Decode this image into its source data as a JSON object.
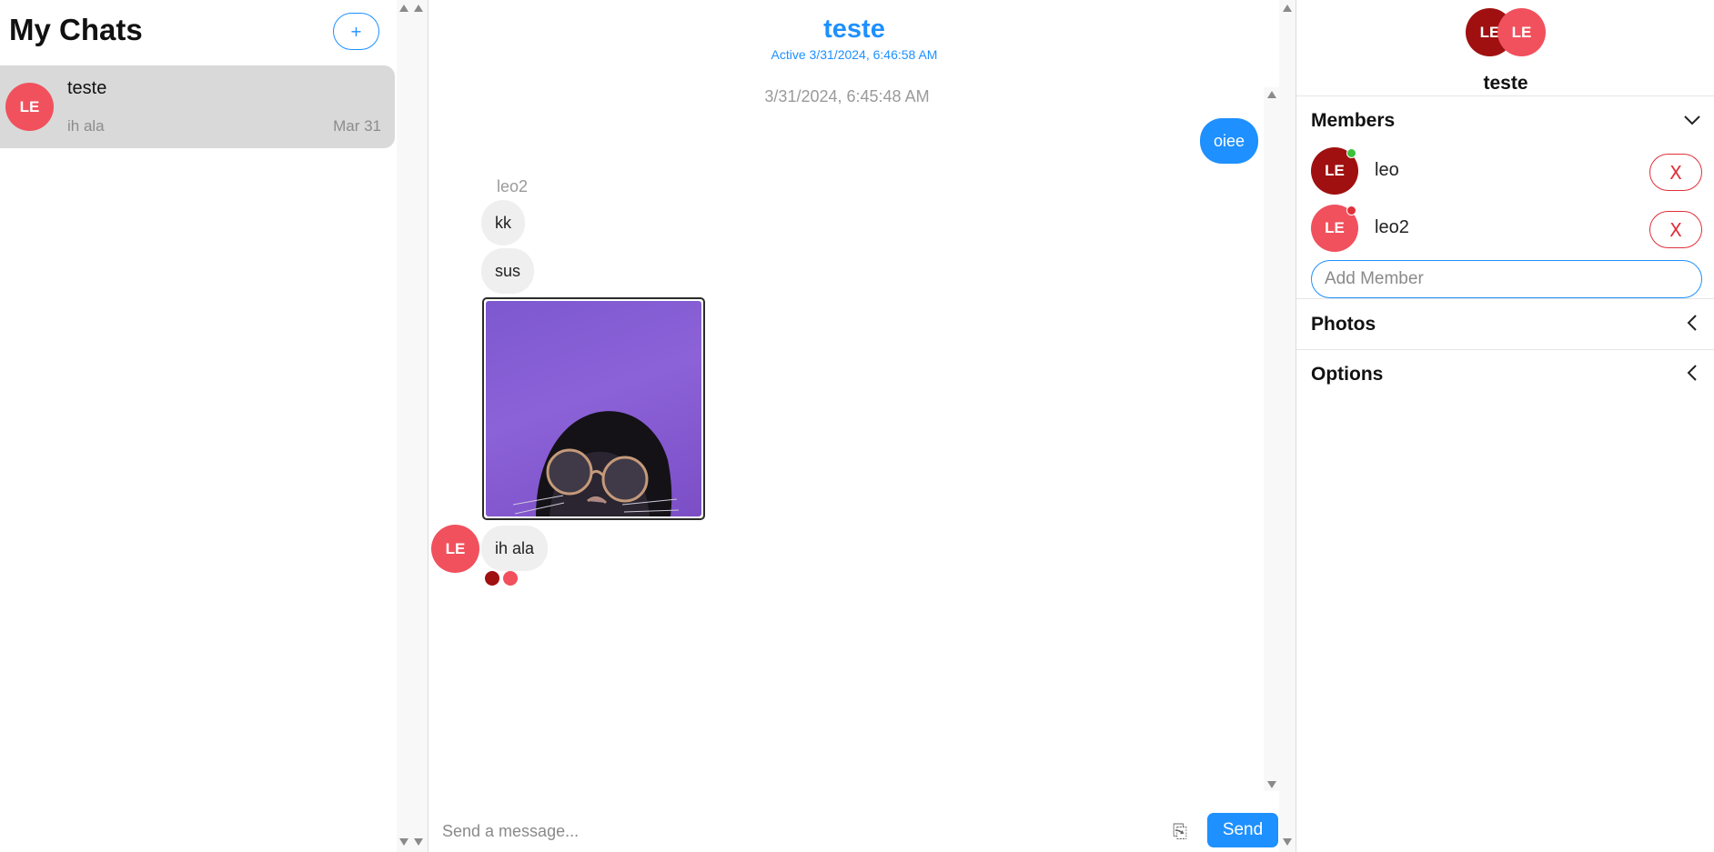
{
  "sidebar": {
    "title": "My Chats",
    "new_chat_label": "+",
    "chats": [
      {
        "initials": "LE",
        "name": "teste",
        "last_message": "ih ala",
        "date": "Mar 31",
        "avatar_color": "#f0515d",
        "selected": true
      }
    ]
  },
  "chat": {
    "title": "teste",
    "active_status": "Active 3/31/2024, 6:46:58 AM",
    "timestamp": "3/31/2024, 6:45:48 AM",
    "messages": [
      {
        "direction": "out",
        "text": "oiee"
      },
      {
        "direction": "in",
        "sender": "leo2",
        "text": "kk"
      },
      {
        "direction": "in",
        "text": "sus"
      },
      {
        "direction": "in",
        "type": "image"
      },
      {
        "direction": "in",
        "text": "ih ala",
        "avatar_initials": "LE"
      }
    ],
    "read_receipt_colors": [
      "#a01010",
      "#f0515d"
    ],
    "composer": {
      "placeholder": "Send a message...",
      "send_label": "Send",
      "attach_icon": "paperclip-icon"
    }
  },
  "details": {
    "group_avatars": [
      {
        "initials": "LE",
        "color": "#a01010"
      },
      {
        "initials": "LE",
        "color": "#f0515d"
      }
    ],
    "group_name": "teste",
    "members_title": "Members",
    "members": [
      {
        "initials": "LE",
        "name": "leo",
        "avatar_color": "#a01010",
        "status": "online",
        "status_color": "#3cc13b",
        "remove_label": "X"
      },
      {
        "initials": "LE",
        "name": "leo2",
        "avatar_color": "#f0515d",
        "status": "offline",
        "status_color": "#e0303a",
        "remove_label": "X"
      }
    ],
    "add_member_placeholder": "Add Member",
    "photos_title": "Photos",
    "options_title": "Options"
  },
  "colors": {
    "accent": "#1e90ff",
    "danger": "#e0303a",
    "selected_chat": "#d9d9d9"
  }
}
